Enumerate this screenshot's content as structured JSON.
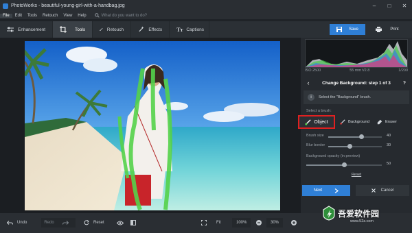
{
  "window": {
    "title": "PhotoWorks - beautiful-young-girl-with-a-handbag.jpg",
    "app_icon": "photoworks-logo-icon"
  },
  "menu": {
    "items": [
      "File",
      "Edit",
      "Tools",
      "Retouch",
      "View",
      "Help"
    ],
    "search_placeholder": "What do you want to do?"
  },
  "tabs": [
    {
      "label": "Enhancement",
      "icon": "sliders-icon"
    },
    {
      "label": "Tools",
      "icon": "crop-icon",
      "active": true
    },
    {
      "label": "Retouch",
      "icon": "brush-icon"
    },
    {
      "label": "Effects",
      "icon": "magic-wand-icon"
    },
    {
      "label": "Captions",
      "icon": "text-icon"
    }
  ],
  "actions": {
    "save_label": "Save",
    "print_label": "Print",
    "accent": "#2f7fd6"
  },
  "exif": {
    "iso": "ISO 2500",
    "lens": "55 mm f/2.8",
    "shutter": "1/200"
  },
  "panel": {
    "step_title": "Change Background: step 1 of 3",
    "help": "?",
    "hint": "Select the \"Background\" brush.",
    "select_label": "Select a brush:",
    "brushes": {
      "object": "Object",
      "background": "Background",
      "eraser": "Eraser"
    },
    "brush_size": {
      "label": "Brush size",
      "value": "40",
      "level": 0.62
    },
    "blur_border": {
      "label": "Blur border",
      "value": "30",
      "level": 0.4
    },
    "opacity": {
      "label": "Background opacity (in preview)",
      "value": "50",
      "level": 0.5
    },
    "reset_label": "Reset",
    "next_label": "Next",
    "cancel_label": "Cancel",
    "highlight_color": "#e02020"
  },
  "bottom": {
    "undo_label": "Undo",
    "redo_label": "Redo",
    "reset_label": "Reset",
    "fit_label": "Fit",
    "zoom_100": "100%",
    "zoom_value": "30%"
  },
  "watermark": {
    "text": "吾爱软件园",
    "url": "www.52z.com"
  }
}
